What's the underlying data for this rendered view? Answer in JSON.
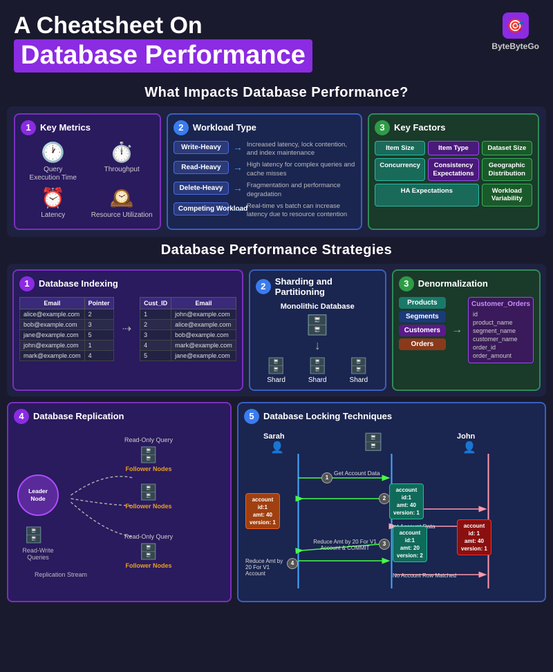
{
  "header": {
    "line1": "A Cheatsheet On",
    "line2": "Database Performance",
    "logo_brand": "ByteByteGo"
  },
  "section1_title": "What Impacts Database Performance?",
  "section2_title": "Database Performance Strategies",
  "metrics": {
    "title": "Key Metrics",
    "num": "1",
    "items": [
      {
        "label": "Query Execution Time",
        "icon": "🕐"
      },
      {
        "label": "Throughput",
        "icon": "⏱️"
      },
      {
        "label": "Latency",
        "icon": "⏰"
      },
      {
        "label": "Resource Utilization",
        "icon": "🕰️"
      }
    ]
  },
  "workload": {
    "title": "Workload Type",
    "num": "2",
    "rows": [
      {
        "tag": "Write-Heavy",
        "desc": "Increased latency, lock contention, and index maintenance"
      },
      {
        "tag": "Read-Heavy",
        "desc": "High latency for complex queries and cache misses"
      },
      {
        "tag": "Delete-Heavy",
        "desc": "Fragmentation and performance degradation"
      },
      {
        "tag": "Competing Workload",
        "desc": "Real-time vs batch can increase latency due to resource contention"
      }
    ]
  },
  "factors": {
    "title": "Key Factors",
    "num": "3",
    "items": [
      {
        "label": "Item Size",
        "style": "ft-teal"
      },
      {
        "label": "Item Type",
        "style": "ft-purple"
      },
      {
        "label": "Dataset Size",
        "style": "ft-green"
      },
      {
        "label": "Concurrency",
        "style": "ft-teal"
      },
      {
        "label": "Consistency Expectations",
        "style": "ft-purple"
      },
      {
        "label": "Geographic Distribution",
        "style": "ft-green"
      },
      {
        "label": "HA Expectations",
        "style": "ft-teal"
      },
      {
        "label": "Workload Variability",
        "style": "ft-green"
      }
    ]
  },
  "indexing": {
    "title": "Database Indexing",
    "num": "1",
    "table1_headers": [
      "Email",
      "Pointer"
    ],
    "table1_rows": [
      [
        "alice@example.com",
        "2"
      ],
      [
        "bob@example.com",
        "3"
      ],
      [
        "jane@example.com",
        "5"
      ],
      [
        "john@example.com",
        "1"
      ],
      [
        "mark@example.com",
        "4"
      ]
    ],
    "table2_headers": [
      "Cust_ID",
      "Email"
    ],
    "table2_rows": [
      [
        "1",
        "john@example.com"
      ],
      [
        "2",
        "alice@example.com"
      ],
      [
        "3",
        "bob@example.com"
      ],
      [
        "4",
        "mark@example.com"
      ],
      [
        "5",
        "jane@example.com"
      ]
    ]
  },
  "sharding": {
    "title": "Sharding and Partitioning",
    "num": "2",
    "monolithic_label": "Monolithic Database",
    "shard_label": "Shard"
  },
  "denorm": {
    "title": "Denormalization",
    "num": "3",
    "entities": [
      "Products",
      "Segments",
      "Customers",
      "Orders"
    ],
    "customer_orders_title": "Customer_Orders",
    "customer_orders_fields": [
      "id",
      "product_name",
      "segment_name",
      "customer_name",
      "order_id",
      "order_amount"
    ]
  },
  "replication": {
    "title": "Database Replication",
    "num": "4",
    "leader_label": "Leader Node",
    "follower_labels": [
      "Follower Nodes",
      "Follower Nodes",
      "Follower Nodes"
    ],
    "rw_label": "Read-Write Queries",
    "ro_label1": "Read-Only Query",
    "ro_label2": "Read-Only Query",
    "stream_label": "Replication Stream"
  },
  "locking": {
    "title": "Database Locking Techniques",
    "num": "5",
    "person1": "Sarah",
    "person2": "John",
    "steps": [
      {
        "num": "1",
        "label": "Get Account Data"
      },
      {
        "num": "2",
        "label": ""
      },
      {
        "num": "3",
        "label": "Reduce Amt by 20 For V1 Account & COMMIT"
      },
      {
        "num": "4",
        "label": "Reduce Amt by 20 For V1 Account"
      }
    ],
    "card1": {
      "text": "account\nid:1\namt: 40\nversion: 1"
    },
    "card2": {
      "text": "account\nid:1\namt: 40\nversion: 1"
    },
    "card3": {
      "text": "account\nid:1\namt: 20\nversion: 2"
    },
    "card4": {
      "text": "account\nid: 1\namt: 40\nversion: 1"
    },
    "no_match_label": "No Account Row Matched",
    "get_account_label2": "Get Account Data"
  }
}
